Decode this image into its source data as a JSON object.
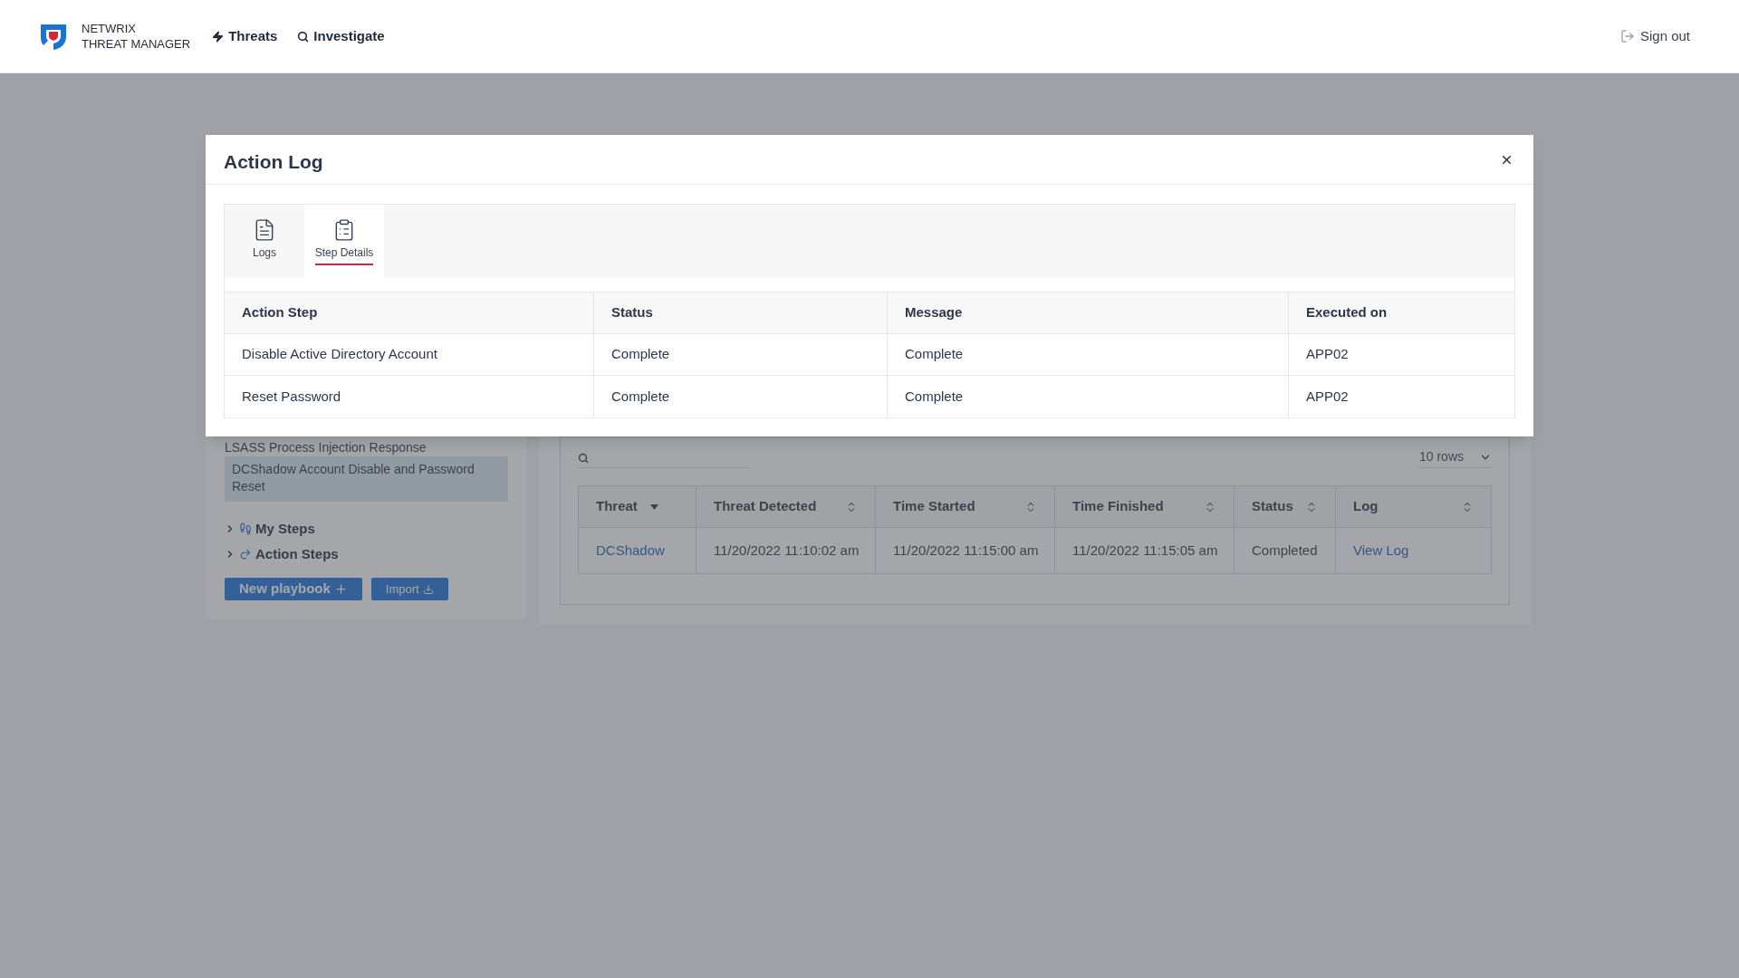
{
  "header": {
    "brand": [
      "NETWRIX",
      "THREAT MANAGER"
    ],
    "nav": [
      "Threats",
      "Investigate"
    ],
    "sign_out": "Sign out"
  },
  "sidebar": {
    "playbooks": [
      {
        "label": "LSASS Process Injection Response",
        "selected": false
      },
      {
        "label": "DCShadow Account Disable and Password  Reset",
        "selected": true
      }
    ],
    "groups": [
      {
        "label": "My Steps",
        "expanded": false
      },
      {
        "label": "Action Steps",
        "expanded": false
      }
    ],
    "buttons": [
      {
        "label": "New playbook",
        "kind": "primary"
      },
      {
        "label": "Import",
        "kind": "secondary"
      }
    ]
  },
  "runs": {
    "rows_selector": "10 rows",
    "columns": [
      {
        "label": "Threat",
        "sorted": true
      },
      {
        "label": "Threat Detected",
        "sorted": false
      },
      {
        "label": "Time Started",
        "sorted": false
      },
      {
        "label": "Time Finished",
        "sorted": false
      },
      {
        "label": "Status",
        "sorted": false
      },
      {
        "label": "Log",
        "sorted": false
      }
    ],
    "rows": [
      [
        {
          "text": "DCShadow",
          "link": true
        },
        {
          "text": "11/20/2022 11:10:02 am",
          "link": false
        },
        {
          "text": "11/20/2022 11:15:00 am",
          "link": false
        },
        {
          "text": "11/20/2022 11:15:05 am",
          "link": false
        },
        {
          "text": "Completed",
          "link": false
        },
        {
          "text": "View Log",
          "link": true
        }
      ]
    ]
  },
  "dialog": {
    "title": "Action Log",
    "tabs": [
      {
        "label": "Logs",
        "selected": false
      },
      {
        "label": "Step Details",
        "selected": true
      }
    ],
    "columns": [
      "Action Step",
      "Status",
      "Message",
      "Executed on"
    ],
    "rows": [
      [
        "Disable Active Directory Account",
        "Complete",
        "Complete",
        "APP02"
      ],
      [
        "Reset Password",
        "Complete",
        "Complete",
        "APP02"
      ]
    ]
  }
}
